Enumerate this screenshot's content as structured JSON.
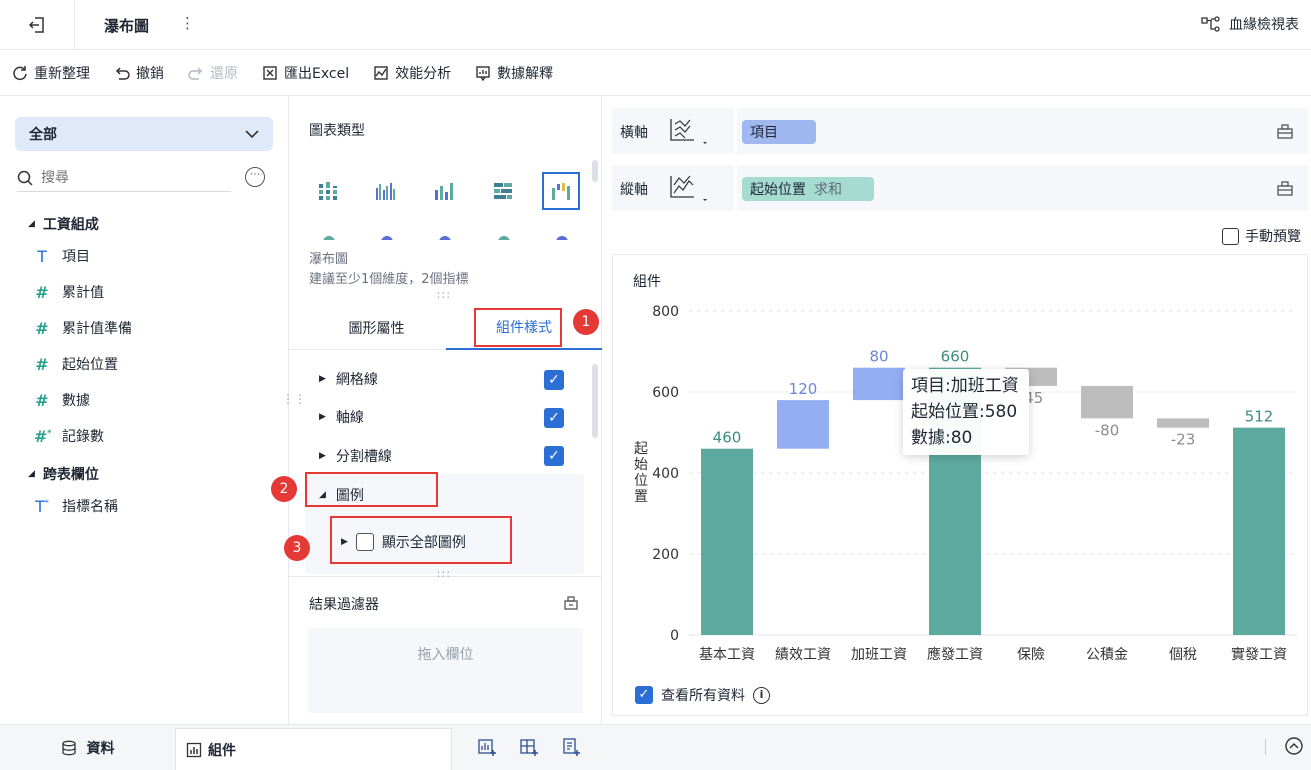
{
  "topbar": {
    "title": "瀑布圖",
    "menu": "⋮",
    "lineage_label": "血緣檢視表"
  },
  "toolbar": {
    "refresh": "重新整理",
    "undo": "撤銷",
    "redo": "還原",
    "export_excel": "匯出Excel",
    "performance": "效能分析",
    "data_explain": "數據解釋"
  },
  "left": {
    "dataset": "全部",
    "search_placeholder": "搜尋",
    "more": "⋯",
    "groups": [
      {
        "label": "工資組成",
        "fields": [
          {
            "type": "text",
            "label": "項目"
          },
          {
            "type": "number",
            "label": "累計值"
          },
          {
            "type": "number",
            "label": "累計值準備"
          },
          {
            "type": "number",
            "label": "起始位置"
          },
          {
            "type": "number",
            "label": "數據"
          },
          {
            "type": "number",
            "label": "記錄數"
          }
        ]
      },
      {
        "label": "跨表欄位",
        "fields": [
          {
            "type": "text-calc",
            "label": "指標名稱"
          }
        ]
      }
    ]
  },
  "mid": {
    "chart_type_title": "圖表類型",
    "chart_name": "瀑布圖",
    "chart_hint": "建議至少1個維度，2個指標",
    "tabs": {
      "shape": "圖形屬性",
      "style": "組件樣式"
    },
    "props": [
      {
        "label": "網格線",
        "checked": true
      },
      {
        "label": "軸線",
        "checked": true
      },
      {
        "label": "分割槽線",
        "checked": true
      },
      {
        "label": "圖例",
        "expanded": true
      }
    ],
    "legend_option": {
      "label": "顯示全部圖例",
      "checked": false
    },
    "callouts": [
      "1",
      "2",
      "3"
    ],
    "filter_title": "結果過濾器",
    "filter_drop": "拖入欄位"
  },
  "right": {
    "x_axis_label": "橫軸",
    "x_field": "項目",
    "y_axis_label": "縱軸",
    "y_field": "起始位置",
    "y_agg": "求和",
    "manual_preview": "手動預覽",
    "chart_title": "組件",
    "view_all": "查看所有資料",
    "info_icon": "i",
    "tooltip": {
      "line1": "項目:加班工資",
      "line2": "起始位置:580",
      "line3": "數據:80"
    }
  },
  "colors": {
    "accent": "#2b6fd6",
    "total": "#5faaa0",
    "increase": "#93aef2",
    "decrease": "#bdbdbd",
    "callout": "#e53935"
  },
  "chart_data": {
    "type": "bar",
    "subtype": "waterfall",
    "ylabel": "起始位置",
    "ylim": [
      0,
      800
    ],
    "yticks": [
      0,
      200,
      400,
      600,
      800
    ],
    "categories": [
      "基本工資",
      "績效工資",
      "加班工資",
      "應發工資",
      "保險",
      "公積金",
      "個稅",
      "實發工資"
    ],
    "bars": [
      {
        "start": 0,
        "end": 460,
        "label": "460",
        "kind": "total"
      },
      {
        "start": 460,
        "end": 580,
        "label": "120",
        "kind": "increase"
      },
      {
        "start": 580,
        "end": 660,
        "label": "80",
        "kind": "increase"
      },
      {
        "start": 0,
        "end": 660,
        "label": "660",
        "kind": "total"
      },
      {
        "start": 660,
        "end": 615,
        "label": "-45",
        "kind": "decrease"
      },
      {
        "start": 615,
        "end": 535,
        "label": "-80",
        "kind": "decrease"
      },
      {
        "start": 535,
        "end": 512,
        "label": "-23",
        "kind": "decrease"
      },
      {
        "start": 0,
        "end": 512,
        "label": "512",
        "kind": "total"
      }
    ]
  },
  "bottombar": {
    "data_tab": "資料",
    "widget_tab": "組件"
  }
}
